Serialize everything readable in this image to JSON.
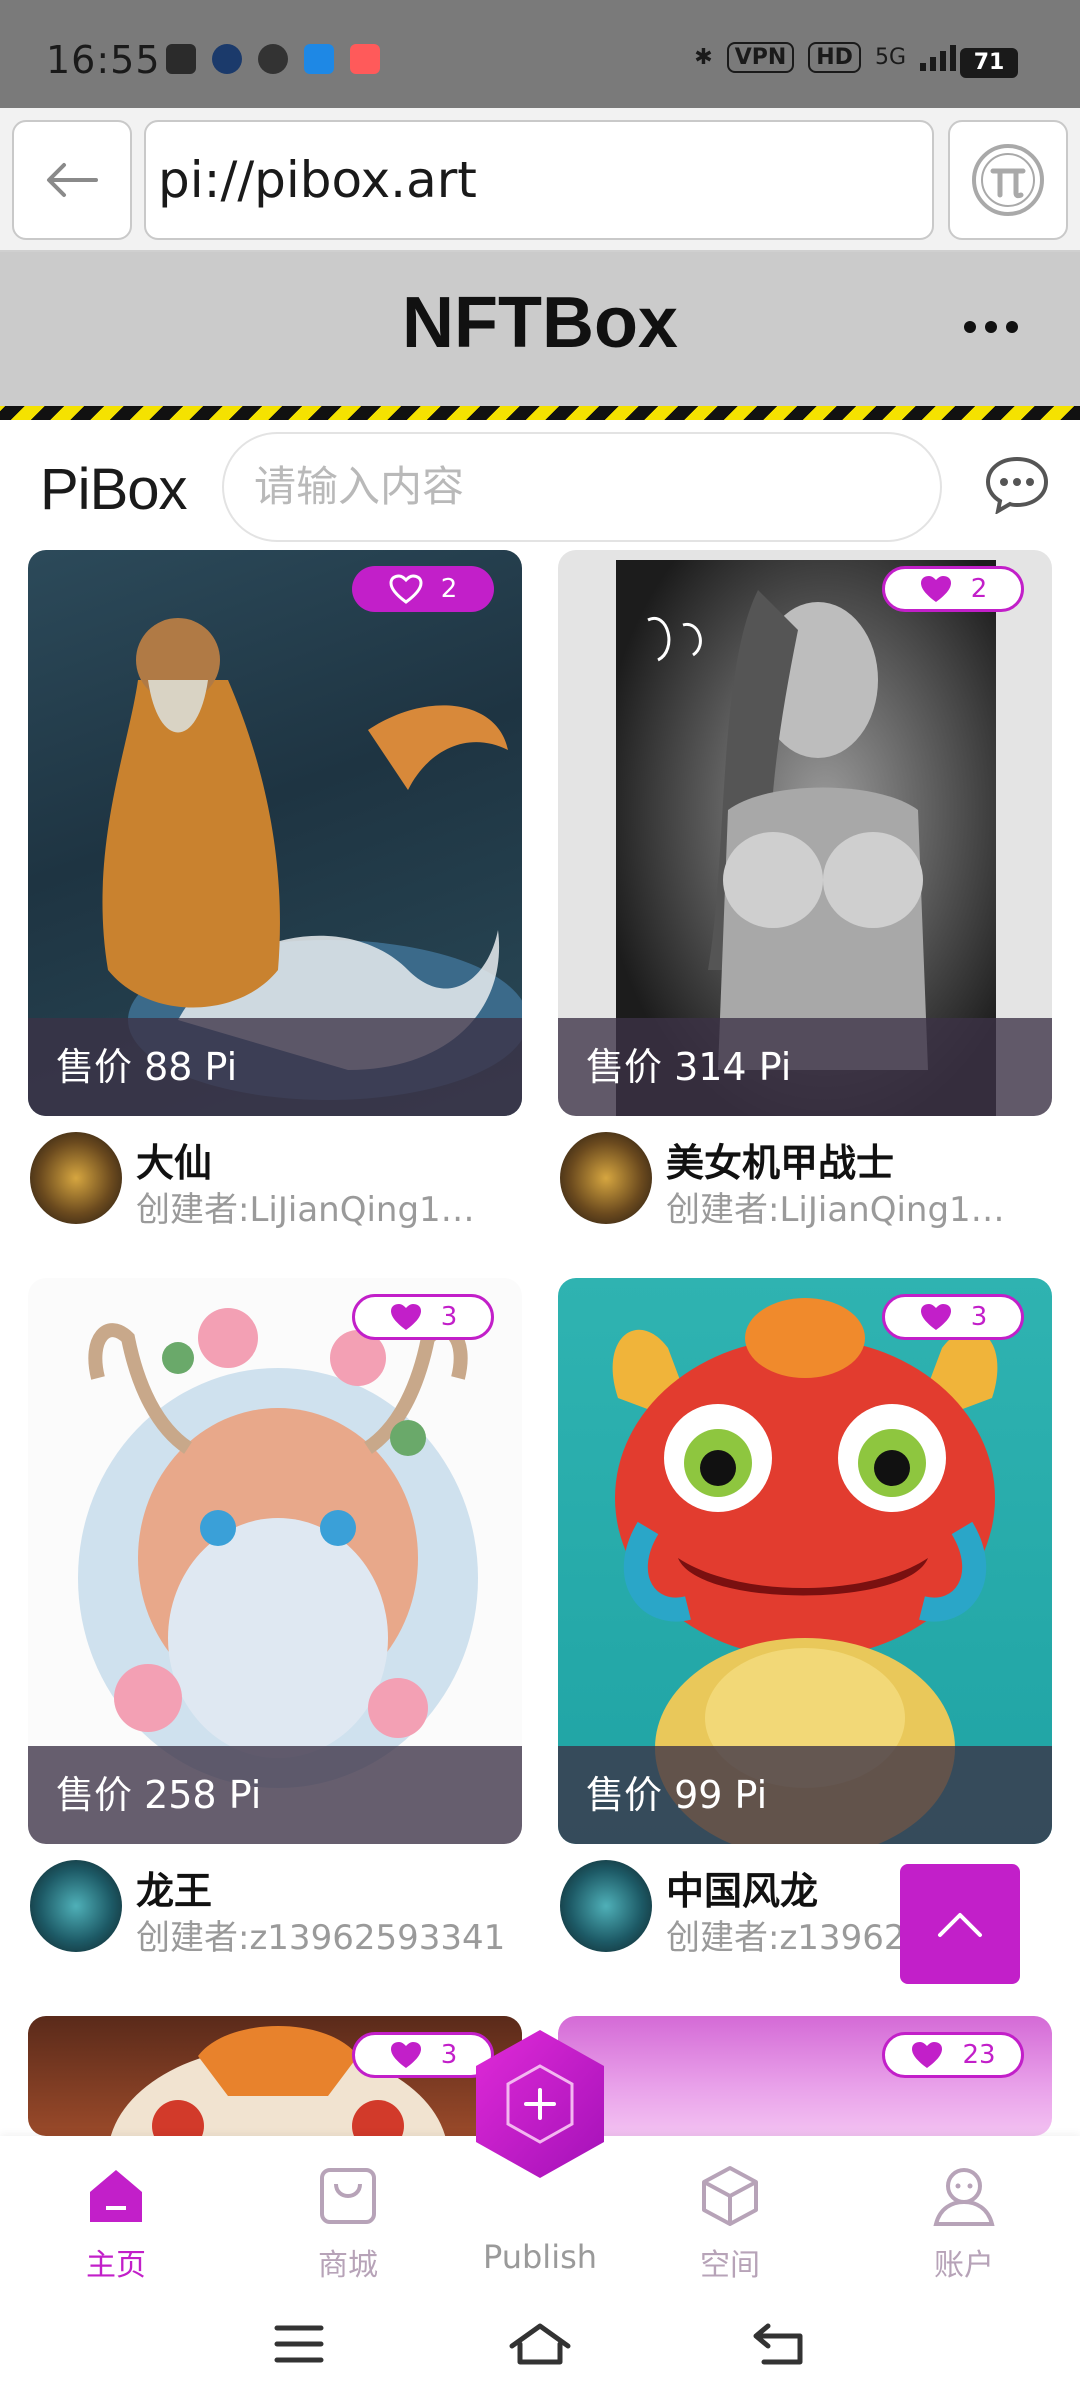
{
  "status_bar": {
    "time": "16:55",
    "vpn": "VPN",
    "hd": "HD",
    "signal": "5G",
    "battery": "71"
  },
  "browser": {
    "url": "pi://pibox.art"
  },
  "header": {
    "title": "NFTBox"
  },
  "search": {
    "brand": "PiBox",
    "placeholder": "请输入内容"
  },
  "cards": [
    {
      "likes": "2",
      "price": "售价 88 Pi",
      "title": "大仙",
      "creator": "创建者:LiJianQing1…",
      "liked": false
    },
    {
      "likes": "2",
      "price": "售价 314 Pi",
      "title": "美女机甲战士",
      "creator": "创建者:LiJianQing1…",
      "liked": true
    },
    {
      "likes": "3",
      "price": "售价 258 Pi",
      "title": "龙王",
      "creator": "创建者:z13962593341",
      "liked": true
    },
    {
      "likes": "3",
      "price": "售价 99 Pi",
      "title": "中国风龙",
      "creator": "创建者:z13962",
      "liked": true
    },
    {
      "likes": "3",
      "liked": true
    },
    {
      "likes": "23",
      "liked": true
    }
  ],
  "nav": {
    "home": "主页",
    "shop": "商城",
    "publish": "Publish",
    "space": "空间",
    "account": "账户"
  },
  "colors": {
    "accent": "#c21fc9",
    "muted_nav": "#b7a3b8"
  }
}
